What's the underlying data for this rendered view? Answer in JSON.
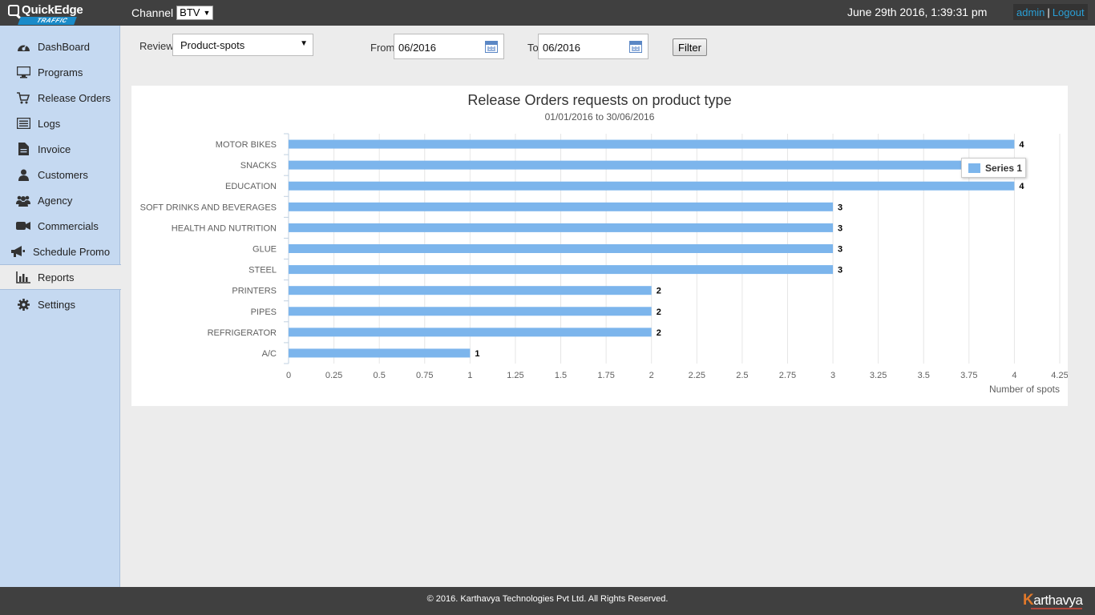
{
  "header": {
    "logo_text": "QuickEdge",
    "logo_sub": "TRAFFIC",
    "channel_label": "Channel",
    "channel_value": "BTV",
    "datetime": "June 29th 2016, 1:39:31 pm",
    "user": "admin",
    "separator": "|",
    "logout": "Logout"
  },
  "sidebar": {
    "items": [
      {
        "label": "DashBoard",
        "icon": "dashboard-icon"
      },
      {
        "label": "Programs",
        "icon": "monitor-icon"
      },
      {
        "label": "Release Orders",
        "icon": "cart-icon"
      },
      {
        "label": "Logs",
        "icon": "list-icon"
      },
      {
        "label": "Invoice",
        "icon": "document-icon"
      },
      {
        "label": "Customers",
        "icon": "user-icon"
      },
      {
        "label": "Agency",
        "icon": "users-icon"
      },
      {
        "label": "Commercials",
        "icon": "video-camera-icon"
      },
      {
        "label": "Schedule Promo",
        "icon": "megaphone-icon"
      },
      {
        "label": "Reports",
        "icon": "bar-chart-icon"
      },
      {
        "label": "Settings",
        "icon": "gear-icon"
      }
    ],
    "active": "Reports"
  },
  "filters": {
    "review_label": "Review",
    "review_value": "Product-spots",
    "from_label": "From",
    "from_value": "06/2016",
    "to_label": "To",
    "to_value": "06/2016",
    "filter_button": "Filter"
  },
  "chart_data": {
    "type": "bar",
    "orientation": "horizontal",
    "title": "Release Orders requests on product type",
    "subtitle": "01/01/2016 to 30/06/2016",
    "categories": [
      "MOTOR BIKES",
      "SNACKS",
      "EDUCATION",
      "SOFT DRINKS AND BEVERAGES",
      "HEALTH AND NUTRITION",
      "GLUE",
      "STEEL",
      "PRINTERS",
      "PIPES",
      "REFRIGERATOR",
      "A/C"
    ],
    "series": [
      {
        "name": "Series 1",
        "color": "#7cb5ec",
        "values": [
          4,
          4,
          4,
          3,
          3,
          3,
          3,
          2,
          2,
          2,
          1
        ]
      }
    ],
    "value_axis_label": "Number of spots",
    "xlim": [
      0,
      4.25
    ],
    "ticks": [
      "0",
      "0.25",
      "0.5",
      "0.75",
      "1",
      "1.25",
      "1.5",
      "1.75",
      "2",
      "2.25",
      "2.5",
      "2.75",
      "3",
      "3.25",
      "3.5",
      "3.75",
      "4",
      "4.25"
    ],
    "data_labels": true,
    "grid": true,
    "legend_position": "top-right"
  },
  "footer": {
    "copyright": "© 2016. Karthavya Technologies Pvt Ltd. All Rights Reserved.",
    "brand_initial": "K",
    "brand_rest": "arthavya"
  }
}
